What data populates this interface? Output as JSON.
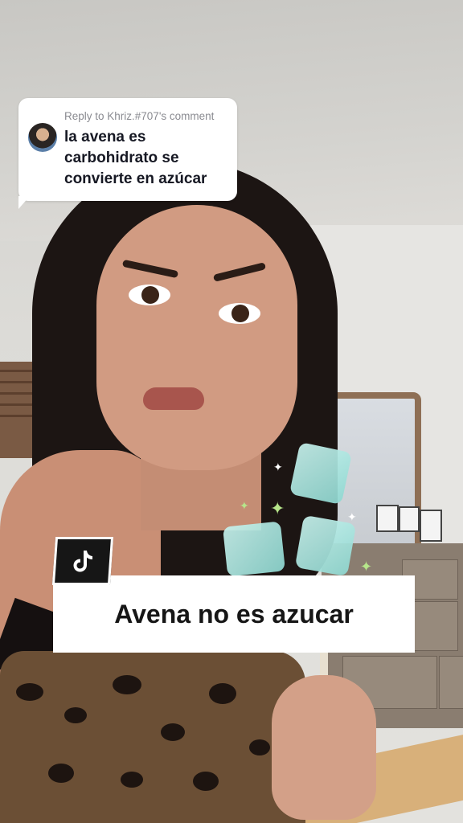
{
  "comment_reply": {
    "reply_to": "Reply to Khriz.#707's comment",
    "text": "la avena es carbohidrato se convierte en azúcar"
  },
  "caption": {
    "text": "Avena no es azucar",
    "logo": "tiktok-logo-icon"
  },
  "effects": {
    "icons": [
      "sugar-cube-icon",
      "sparkle-icon"
    ],
    "cube_color": "#a9e9e2",
    "sparkle_color": "#b6e58a"
  }
}
